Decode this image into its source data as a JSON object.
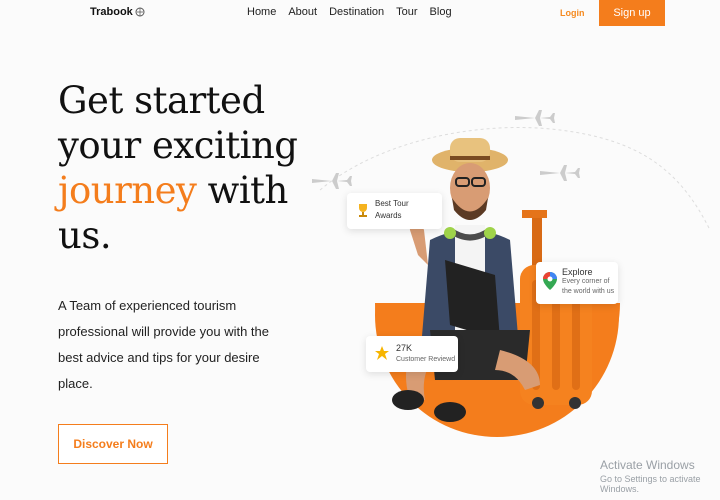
{
  "nav": {
    "logo": "Trabook",
    "items": [
      "Home",
      "About",
      "Destination",
      "Tour",
      "Blog"
    ],
    "login": "Login",
    "signup": "Sign up"
  },
  "hero": {
    "headline_line1": "Get started",
    "headline_line2": "your exciting",
    "headline_accent": "journey",
    "headline_rest": " with",
    "headline_line4": "us.",
    "paragraph": "A Team of experienced tourism professional will provide you with the best advice and tips for your desire place.",
    "cta": "Discover Now"
  },
  "cards": {
    "award": {
      "line1": "Best Tour",
      "line2": "Awards"
    },
    "explore": {
      "title": "Explore",
      "line1": "Every corner of",
      "line2": "the world with us"
    },
    "reviews": {
      "count": "27K",
      "label": "Customer Reviewd"
    }
  },
  "watermark": {
    "title": "Activate Windows",
    "subtitle": "Go to Settings to activate Windows."
  },
  "colors": {
    "accent": "#f47d1c",
    "background": "#fbfbfb"
  }
}
